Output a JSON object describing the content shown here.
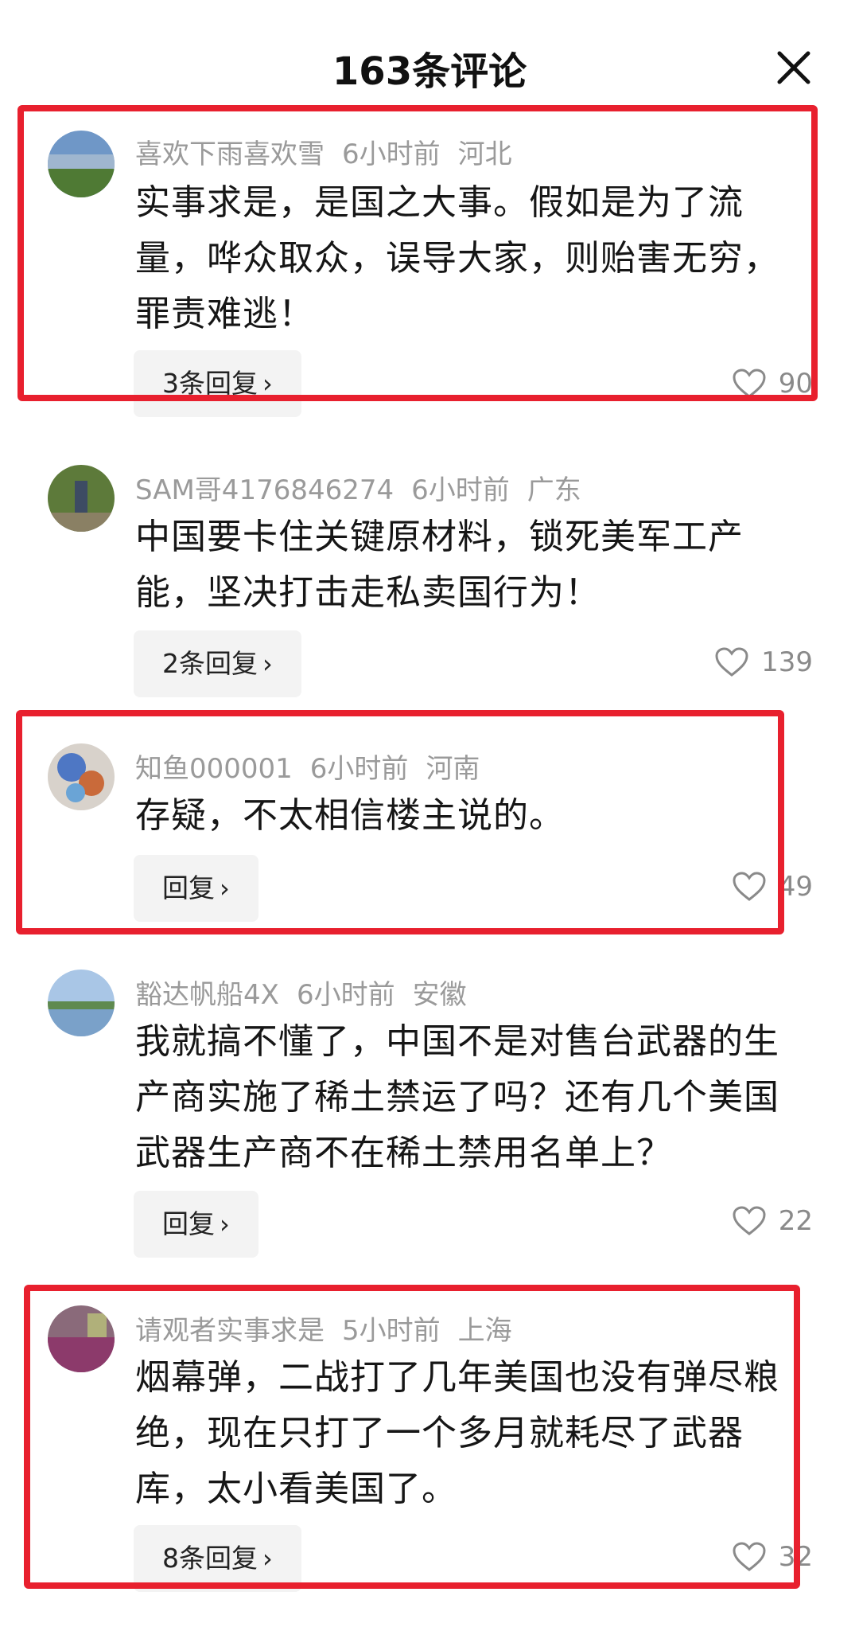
{
  "header": {
    "title": "163条评论",
    "close_icon": "close-icon"
  },
  "comments": [
    {
      "user": "喜欢下雨喜欢雪",
      "time": "6小时前",
      "location": "河北",
      "text": "实事求是，是国之大事。假如是为了流量，哗众取众，误导大家，则贻害无穷，罪责难逃！",
      "reply_label": "3条回复",
      "likes": "90"
    },
    {
      "user": "SAM哥4176846274",
      "time": "6小时前",
      "location": "广东",
      "text": "中国要卡住关键原材料，锁死美军工产能，坚决打击走私卖国行为！",
      "reply_label": "2条回复",
      "likes": "139"
    },
    {
      "user": "知鱼000001",
      "time": "6小时前",
      "location": "河南",
      "text": "存疑，不太相信楼主说的。",
      "reply_label": "回复",
      "likes": "49"
    },
    {
      "user": "豁达帆船4X",
      "time": "6小时前",
      "location": "安徽",
      "text": "我就搞不懂了，中国不是对售台武器的生产商实施了稀土禁运了吗？还有几个美国武器生产商不在稀土禁用名单上？",
      "reply_label": "回复",
      "likes": "22"
    },
    {
      "user": "请观者实事求是",
      "time": "5小时前",
      "location": "上海",
      "text": "烟幕弹，二战打了几年美国也没有弹尽粮绝，现在只打了一个多月就耗尽了武器库，太小看美国了。",
      "reply_label": "8条回复",
      "likes": "32"
    }
  ],
  "colors": {
    "highlight": "#e8202e",
    "meta": "#9a9a9a",
    "reply_bg": "#f3f3f3"
  }
}
